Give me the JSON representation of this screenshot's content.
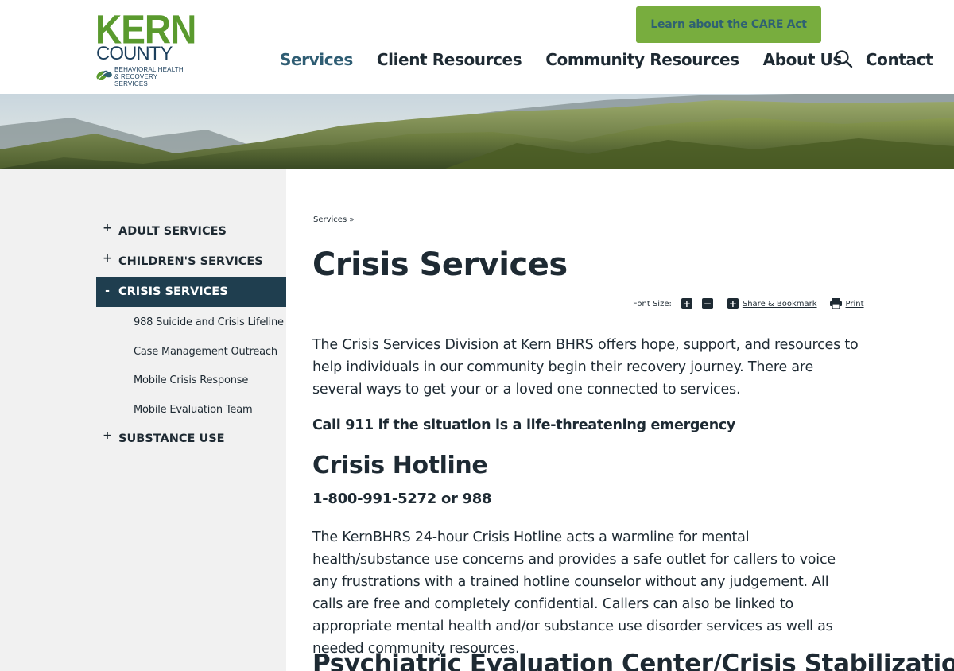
{
  "header": {
    "logo": {
      "line1": "KERN",
      "line2": "COUNTY",
      "line3": "BEHAVIORAL HEALTH",
      "line4": "& RECOVERY SERVICES"
    },
    "care_button": "Learn about the CARE Act",
    "nav": [
      {
        "label": "Services",
        "active": true
      },
      {
        "label": "Client Resources",
        "active": false
      },
      {
        "label": "Community Resources",
        "active": false
      },
      {
        "label": "About Us",
        "active": false
      },
      {
        "label": "Contact",
        "active": false
      }
    ],
    "search_icon": "search-icon"
  },
  "sidebar": {
    "items": [
      {
        "toggle": "+",
        "label": "ADULT SERVICES"
      },
      {
        "toggle": "+",
        "label": "CHILDREN'S SERVICES"
      },
      {
        "toggle": "-",
        "label": "CRISIS SERVICES"
      },
      {
        "toggle": "+",
        "label": "SUBSTANCE USE"
      }
    ],
    "sub_items": [
      "988 Suicide and Crisis Lifeline",
      "Case Management Outreach",
      "Mobile Crisis Response",
      "Mobile Evaluation Team"
    ]
  },
  "main": {
    "breadcrumb_link": "Services",
    "breadcrumb_sep": " »",
    "title": "Crisis Services",
    "tools": {
      "font_size_label": "Font Size:",
      "increase": "+",
      "decrease": "−",
      "share_label": "Share & Bookmark",
      "print_label": "Print"
    },
    "intro": "The Crisis Services Division at Kern BHRS offers hope, support, and resources to help individuals in our community begin their recovery journey. There are several ways to get your or a loved one connected to services.",
    "call911": "Call 911 if the situation is a life-threatening emergency",
    "hotline_title": "Crisis Hotline",
    "hotline_number": "1-800-991-5272 or 988",
    "hotline_body": "The KernBHRS 24-hour Crisis Hotline acts a warmline for mental health/substance use concerns and provides a safe outlet for callers to voice any frustrations with a trained hotline counselor without any judgement. All calls are free and completely confidential. Callers can also be linked to appropriate mental health and/or substance use disorder services as well as needed community resources.",
    "psych_title": "Psychiatric Evaluation Center/Crisis Stabilization Unit"
  },
  "colors": {
    "brand_green": "#78ad3e",
    "logo_green": "#5a9a2e",
    "navy": "#1f3e4f",
    "sidebar_bg": "#f1f1f1",
    "text": "#1e2a33"
  }
}
